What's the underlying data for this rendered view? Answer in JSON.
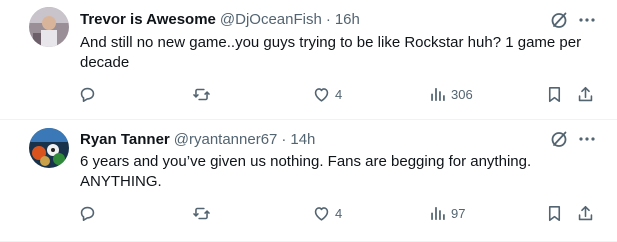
{
  "tweets": [
    {
      "author_name": "Trevor is Awesome",
      "handle": "@DjOceanFish",
      "separator": "·",
      "time": "16h",
      "text": "And still no new game..you guys trying to be like Rockstar huh? 1 game per decade",
      "replies": "",
      "retweets": "",
      "likes": "4",
      "views": "306"
    },
    {
      "author_name": "Ryan Tanner",
      "handle": "@ryantanner67",
      "separator": "·",
      "time": "14h",
      "text": "6 years and you’ve given us nothing. Fans are begging for anything. ANYTHING.",
      "replies": "",
      "retweets": "",
      "likes": "4",
      "views": "97"
    }
  ],
  "colors": {
    "text_primary": "#0f1419",
    "text_secondary": "#536471",
    "divider": "#eff3f4"
  },
  "icons": [
    "grok-icon",
    "more-icon",
    "reply-icon",
    "retweet-icon",
    "like-icon",
    "views-icon",
    "bookmark-icon",
    "share-icon"
  ]
}
